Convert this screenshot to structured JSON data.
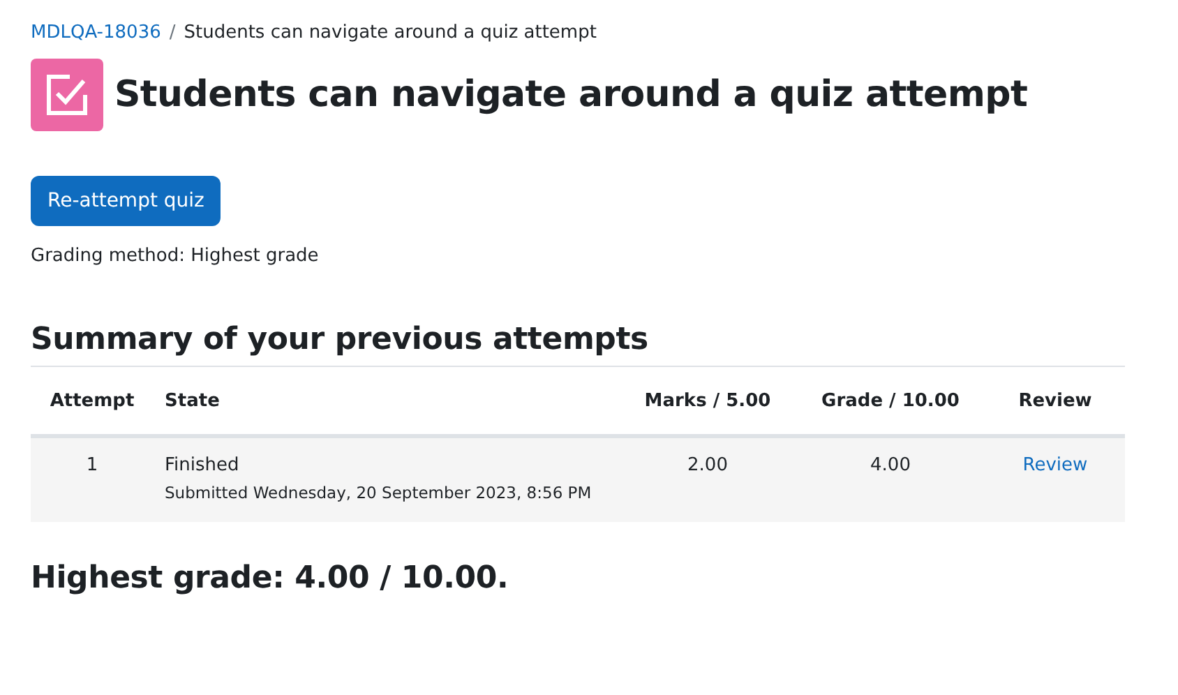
{
  "breadcrumb": [
    {
      "label": "MDLQA-18036",
      "kind": "link"
    },
    {
      "label": "Students can navigate around a quiz attempt",
      "kind": "current"
    }
  ],
  "breadcrumb_separator": "/",
  "title": "Students can navigate around a quiz attempt",
  "reattempt_button": "Re-attempt quiz",
  "grading_method": "Grading method: Highest grade",
  "summary_heading": "Summary of your previous attempts",
  "table": {
    "columns": [
      "Attempt",
      "State",
      "Marks / 5.00",
      "Grade / 10.00",
      "Review"
    ],
    "rows": [
      {
        "attempt": "1",
        "state": "Finished",
        "submitted": "Submitted Wednesday, 20 September 2023, 8:56 PM",
        "marks": "2.00",
        "grade": "4.00",
        "review": "Review"
      }
    ]
  },
  "final_grade": "Highest grade: 4.00 / 10.00."
}
